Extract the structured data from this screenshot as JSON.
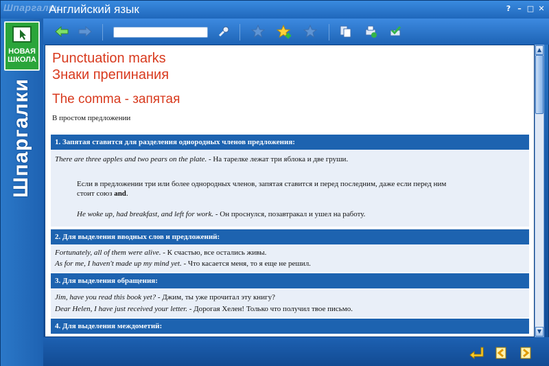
{
  "window": {
    "brand": "Шпаргалки",
    "title": "Английский язык",
    "help": "?",
    "minimize": "–",
    "maximize": "□",
    "close": "✕"
  },
  "rail": {
    "logo_top": "новая",
    "logo_bottom": "школа",
    "vertical_text": "Шпаргалки"
  },
  "toolbar": {
    "search_value": ""
  },
  "content": {
    "heading1": "Punctuation marks",
    "heading2": "Знаки препинания",
    "heading3": "The comma - запятая",
    "intro": "В простом предложении",
    "sections": [
      {
        "title": "1. Запятая ставится для разделения однородных членов предложения:"
      },
      {
        "title": "2. Для выделения вводных слов и предложений:"
      },
      {
        "title": "3. Для выделения обращения:"
      },
      {
        "title": "4. Для выделения междометий:"
      }
    ],
    "s1": {
      "ex1_en": "There are three apples and two pears on the plate.",
      "ex1_ru": " - На тарелке лежат три яблока и две груши.",
      "note1": "Если в предложении три или более однородных членов, запятая ставится и перед последним, даже если перед ним",
      "note2_a": "стоит союз ",
      "note2_b": "and",
      "note2_c": ".",
      "ex2_en": "He woke up, had breakfast, and left for work.",
      "ex2_ru": " - Он проснулся, позавтракал и ушел на работу."
    },
    "s2": {
      "ex1_en": "Fortunately, all of them were alive.",
      "ex1_ru": " - К счастью, все остались живы.",
      "ex2_en": "As for me, I haven't made up my mind yet.",
      "ex2_ru": " - Что касается меня, то я еще не решил."
    },
    "s3": {
      "ex1_en": "Jim, have you read this book yet?",
      "ex1_ru": " - Джим, ты уже прочитал эту книгу?",
      "ex2_en": "Dear Helen, I have just received your letter.",
      "ex2_ru": " - Дорогая Хелен! Только что получил твое письмо."
    }
  },
  "colors": {
    "accent": "#1d63b0",
    "heading": "#d83a1e",
    "panel": "#e9eff8"
  }
}
